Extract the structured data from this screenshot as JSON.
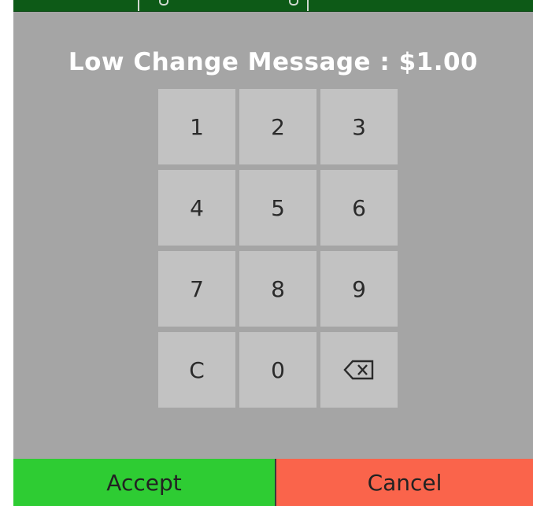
{
  "dialog": {
    "title": "Low Change Message : $1.00"
  },
  "keypad": {
    "keys": [
      "1",
      "2",
      "3",
      "4",
      "5",
      "6",
      "7",
      "8",
      "9",
      "C",
      "0"
    ],
    "backspace_icon": "backspace-icon"
  },
  "actions": {
    "accept_label": "Accept",
    "cancel_label": "Cancel"
  },
  "colors": {
    "panel": "#a5a5a5",
    "key": "#c2c2c2",
    "accept": "#2ecc33",
    "cancel": "#fa644b",
    "top_bar": "#0d5a17"
  }
}
